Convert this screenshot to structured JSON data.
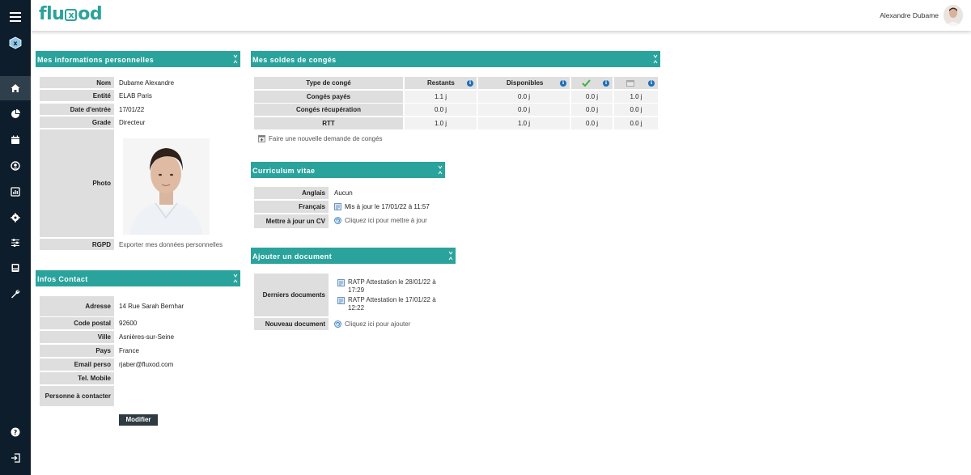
{
  "app": {
    "logo_left": "flu",
    "logo_x": "x",
    "logo_right": "od",
    "user_name": "Alexandre Dubame"
  },
  "sidebar": {
    "icons": [
      "menu-icon",
      "fluxod-app-icon",
      "home-icon",
      "pie-chart-icon",
      "calendar-icon",
      "user-circle-icon",
      "report-icon",
      "settings-gear-icon",
      "sliders-icon",
      "book-icon",
      "wrench-icon",
      "help-icon",
      "logout-icon"
    ]
  },
  "personal": {
    "title": "Mes informations personnelles",
    "rows": [
      {
        "label": "Nom",
        "value": "Dubame Alexandre"
      },
      {
        "label": "Entité",
        "value": "ELAB Paris"
      },
      {
        "label": "Date d'entrée",
        "value": "17/01/22"
      },
      {
        "label": "Grade",
        "value": "Directeur"
      }
    ],
    "photo_label": "Photo",
    "rgpd_label": "RGPD",
    "rgpd_link": "Exporter mes données personnelles"
  },
  "contact": {
    "title": "Infos Contact",
    "rows": [
      {
        "label": "Adresse",
        "value": "14 Rue Sarah Bernhar"
      },
      {
        "label": "Code postal",
        "value": "92600"
      },
      {
        "label": "Ville",
        "value": "Asnières-sur-Seine"
      },
      {
        "label": "Pays",
        "value": "France"
      },
      {
        "label": "Email perso",
        "value": "rjaber@fluxod.com"
      },
      {
        "label": "Tel. Mobile",
        "value": ""
      },
      {
        "label": "Personne à contacter",
        "value": ""
      }
    ],
    "modify_label": "Modifier"
  },
  "leave": {
    "title": "Mes soldes de congés",
    "headers": [
      "Type de congé",
      "Restants",
      "Disponibles",
      "",
      ""
    ],
    "rows": [
      {
        "type": "Congés payés",
        "restants": "1.1 j",
        "disponibles": "0.0 j",
        "approved": "0.0 j",
        "pending": "1.0 j"
      },
      {
        "type": "Congés récupération",
        "restants": "0.0 j",
        "disponibles": "0.0 j",
        "approved": "0.0 j",
        "pending": "0.0 j"
      },
      {
        "type": "RTT",
        "restants": "1.0 j",
        "disponibles": "1.0 j",
        "approved": "0.0 j",
        "pending": "0.0 j"
      }
    ],
    "new_request": "Faire une nouvelle demande de congés",
    "colors": {
      "approved": "#3cb043",
      "info": "#1e6fb8"
    }
  },
  "cv": {
    "title": "Curriculum vitae",
    "rows": [
      {
        "label": "Anglais",
        "value": "Aucun"
      },
      {
        "label": "Français",
        "value": "Mis à jour le 17/01/22 à 11:57"
      },
      {
        "label": "Mettre à jour un CV",
        "value": "Cliquez ici pour mettre à jour"
      }
    ]
  },
  "documents": {
    "title": "Ajouter un document",
    "recent_label": "Derniers documents",
    "recent": [
      "RATP Attestation le 28/01/22 à 17:29",
      "RATP Attestation le 17/01/22 à 12:22"
    ],
    "new_label": "Nouveau document",
    "new_link": "Cliquez ici pour ajouter"
  },
  "theme": {
    "accent": "#2aa39c",
    "sidebar": "#0e1d2b",
    "button": "#2e3b42"
  }
}
